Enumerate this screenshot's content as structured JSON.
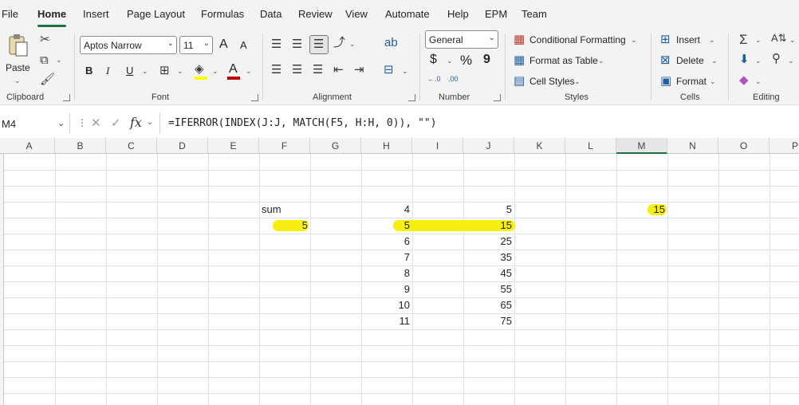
{
  "tabs": [
    "File",
    "Home",
    "Insert",
    "Page Layout",
    "Formulas",
    "Data",
    "Review",
    "View",
    "Automate",
    "Help",
    "EPM",
    "Team"
  ],
  "ribbon": {
    "clipboard": {
      "paste": "Paste",
      "label": "Clipboard"
    },
    "font": {
      "name": "Aptos Narrow",
      "size": "11",
      "label": "Font",
      "bold": "B",
      "italic": "I",
      "underline": "U",
      "grow": "A",
      "shrink": "A",
      "color_letter": "A"
    },
    "alignment": {
      "label": "Alignment"
    },
    "number": {
      "format": "General",
      "currency": "$",
      "percent": "%",
      "comma": "9",
      "inc": "←.0\n.00",
      "dec": ".00\n→.0",
      "label": "Number"
    },
    "styles": {
      "conditional": "Conditional Formatting",
      "table": "Format as Table",
      "cell_styles": "Cell Styles",
      "label": "Styles"
    },
    "cells": {
      "insert": "Insert",
      "delete": "Delete",
      "format": "Format",
      "label": "Cells"
    },
    "editing": {
      "label": "Editing"
    }
  },
  "formula_bar": {
    "name_box": "M4",
    "formula": "=IFERROR(INDEX(J:J, MATCH(F5, H:H, 0)), \"\")",
    "fx": "fx"
  },
  "columns": [
    "A",
    "B",
    "C",
    "D",
    "E",
    "F",
    "G",
    "H",
    "I",
    "J",
    "K",
    "L",
    "M",
    "N",
    "O",
    "P"
  ],
  "cells": {
    "F4": "sum",
    "F5": "5",
    "H": [
      "4",
      "5",
      "6",
      "7",
      "8",
      "9",
      "10",
      "11"
    ],
    "J": [
      "5",
      "15",
      "25",
      "35",
      "45",
      "55",
      "65",
      "75"
    ],
    "M4": "15"
  },
  "colors": {
    "highlight": "#f7ef10",
    "accent": "#1e7145",
    "font_red": "#c00000",
    "fill_yellow": "#ffff00"
  }
}
